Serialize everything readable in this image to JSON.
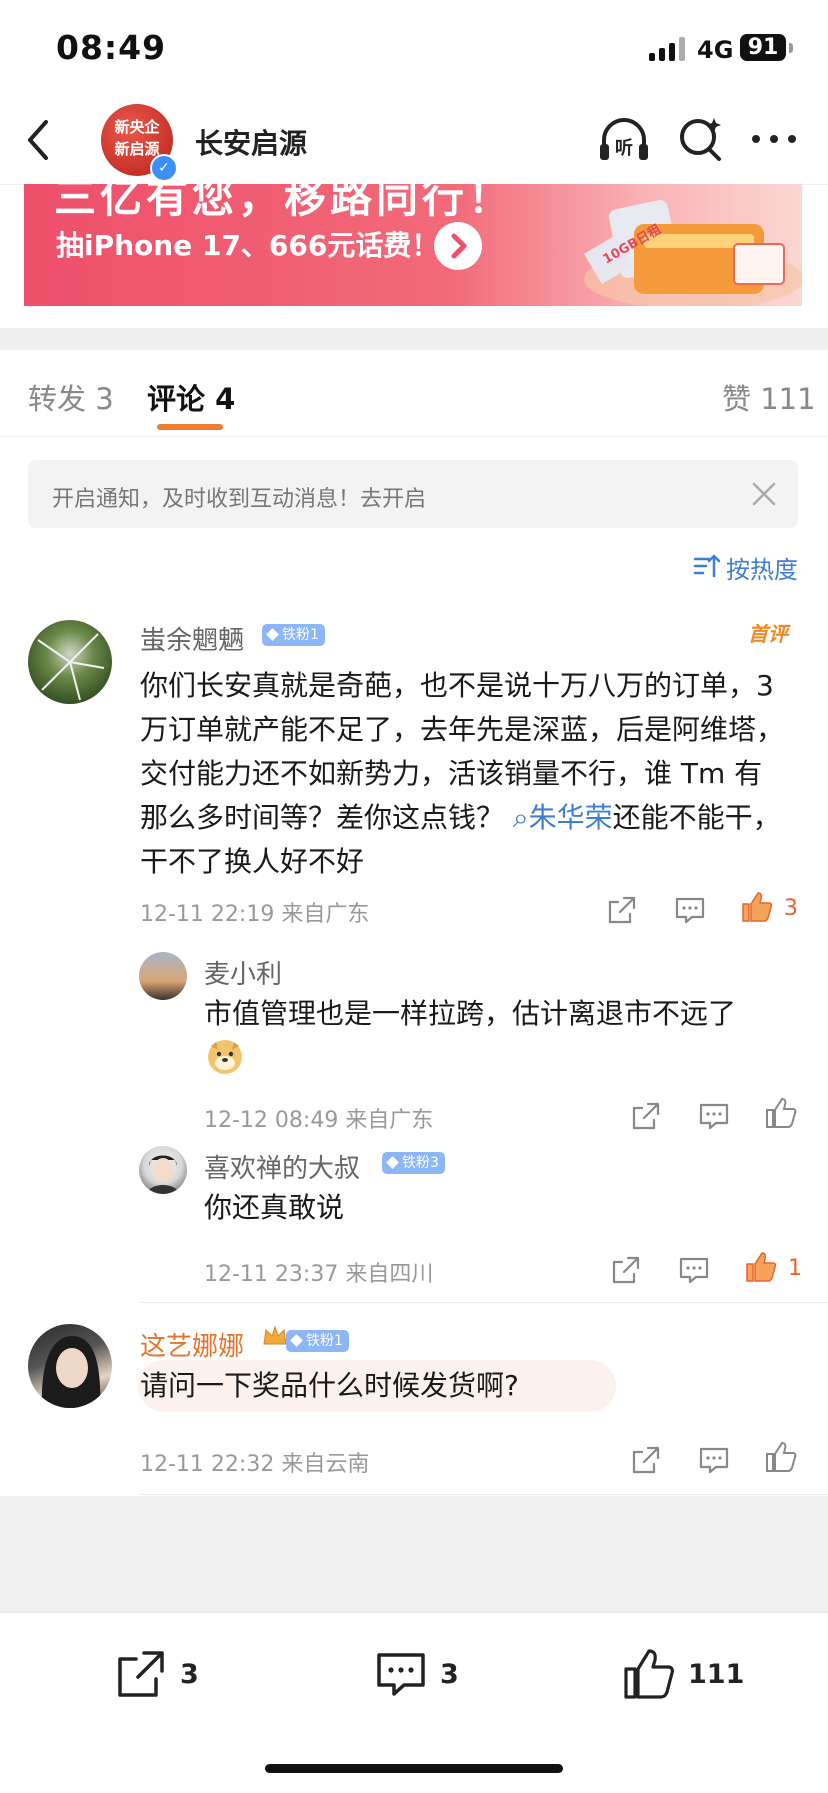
{
  "status_bar": {
    "time": "08:49",
    "network": "4G",
    "battery": "91"
  },
  "header": {
    "account_name": "长安启源",
    "avatar_text": [
      "新央企",
      "新启源"
    ]
  },
  "banner": {
    "title": "三亿有您，移路同行！",
    "subtitle": "抽iPhone 17、666元话费！",
    "tag": "10GB日租"
  },
  "tabs": {
    "repost": "转发 3",
    "comments": "评论 4",
    "likes": "赞 111"
  },
  "notice": {
    "text": "开启通知，及时收到互动消息！去开启"
  },
  "sort": {
    "label": "按热度"
  },
  "comments": [
    {
      "user": "蚩余魍魉",
      "badge": "铁粉1",
      "tag": "首评",
      "text_a": "你们长安真就是奇葩，也不是说十万八万的订单，3万订单就产能不足了，去年先是深蓝，后是阿维塔，交付能力还不如新势力，活该销量不行，谁 Tm 有那么多时间等？差你这点钱？",
      "mention": "朱华荣",
      "text_b": "还能不能干，干不了换人好不好",
      "meta": "12-11 22:19  来自广东",
      "likes": "3",
      "replies": [
        {
          "user": "麦小利",
          "text": "市值管理也是一样拉跨，估计离退市不远了",
          "meta": "12-12 08:49  来自广东",
          "likes": ""
        },
        {
          "user": "喜欢禅的大叔",
          "badge": "铁粉3",
          "text": "你还真敢说",
          "meta": "12-11 23:37  来自四川",
          "likes": "1"
        }
      ]
    },
    {
      "user": "这艺娜娜",
      "badge": "铁粉1",
      "text": "请问一下奖品什么时候发货啊?",
      "meta": "12-11 22:32  来自云南",
      "likes": ""
    }
  ],
  "bottom_bar": {
    "repost_count": "3",
    "comment_count": "3",
    "like_count": "111"
  },
  "colors": {
    "accent_orange": "#f07d32",
    "link_blue": "#3d7fd3",
    "like_orange": "#e8642c",
    "banner_red": "#ee4f6a"
  }
}
